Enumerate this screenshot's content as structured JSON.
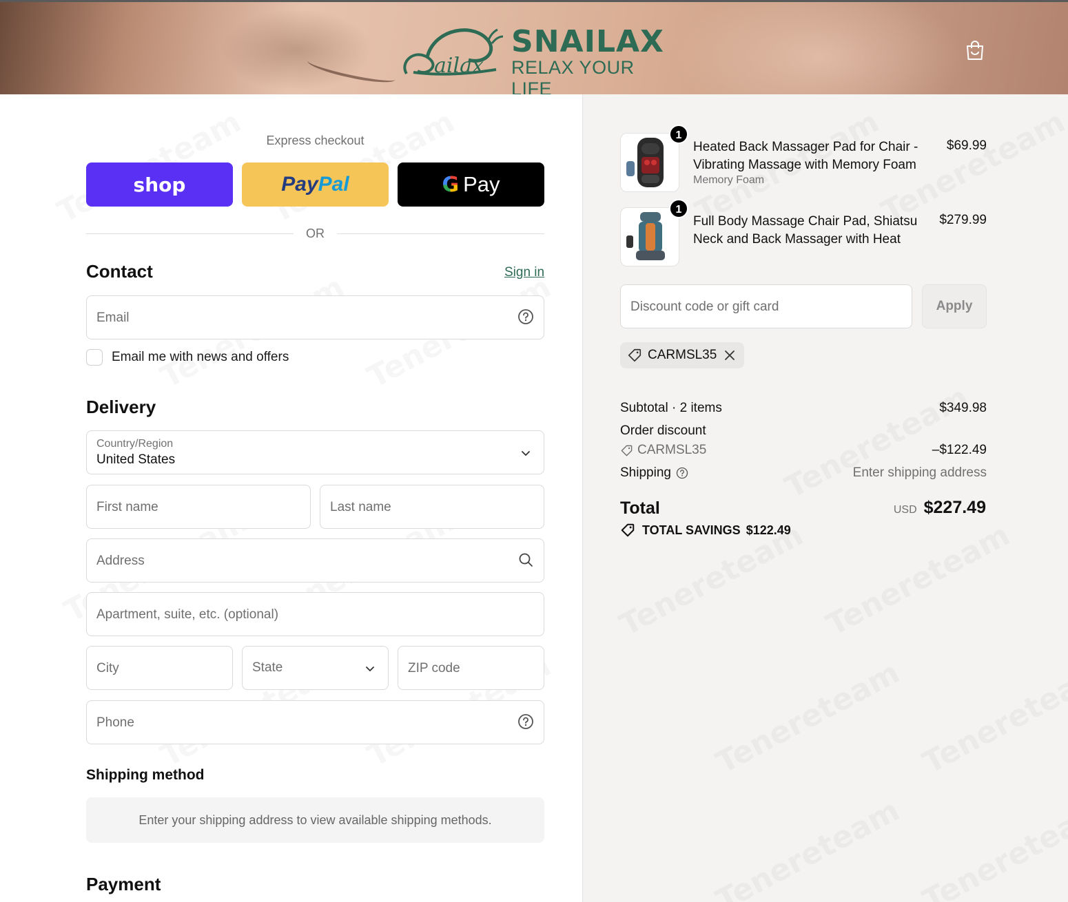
{
  "header": {
    "brand_name": "SNAILAX",
    "tagline": "RELAX YOUR LIFE"
  },
  "express": {
    "label": "Express checkout",
    "shop_label": "shop",
    "paypal_part1": "Pay",
    "paypal_part2": "Pal",
    "gpay_g": "G",
    "gpay_label": "Pay",
    "or_label": "OR"
  },
  "contact": {
    "title": "Contact",
    "sign_in": "Sign in",
    "email_placeholder": "Email",
    "newsletter_label": "Email me with news and offers"
  },
  "delivery": {
    "title": "Delivery",
    "country_label": "Country/Region",
    "country_value": "United States",
    "first_name": "First name",
    "last_name": "Last name",
    "address": "Address",
    "apartment": "Apartment, suite, etc. (optional)",
    "city": "City",
    "state": "State",
    "zip": "ZIP code",
    "phone": "Phone"
  },
  "shipping_method": {
    "title": "Shipping method",
    "message": "Enter your shipping address to view available shipping methods."
  },
  "payment": {
    "title": "Payment"
  },
  "cart": {
    "items": [
      {
        "title_line1": "Heated Back Massager Pad for Chair -",
        "title_line2": "Vibrating Massage with Memory Foam",
        "variant": "Memory Foam",
        "price": "$69.99",
        "qty": "1"
      },
      {
        "title_line1": "Full Body Massage Chair Pad, Shiatsu",
        "title_line2": "Neck and Back Massager with Heat",
        "variant": "",
        "price": "$279.99",
        "qty": "1"
      }
    ],
    "discount_placeholder": "Discount code or gift card",
    "apply_label": "Apply",
    "applied_code": "CARMSL35",
    "subtotal_label": "Subtotal · 2 items",
    "subtotal_value": "$349.98",
    "order_discount_label": "Order discount",
    "order_discount_code": "CARMSL35",
    "order_discount_value": "–$122.49",
    "shipping_label": "Shipping",
    "shipping_value": "Enter shipping address",
    "total_label": "Total",
    "currency": "USD",
    "total_value": "$227.49",
    "savings_label": "TOTAL SAVINGS",
    "savings_value": "$122.49"
  },
  "watermark_text": "Tenereteam",
  "colors": {
    "brand_green": "#2e6b54",
    "shop_purple": "#5a31f4",
    "paypal_yellow": "#f5c557"
  }
}
